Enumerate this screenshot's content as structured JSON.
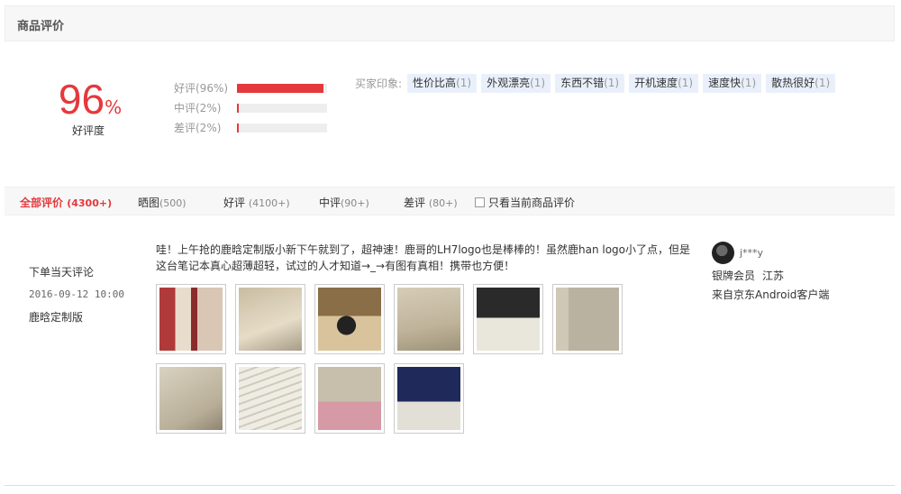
{
  "section": {
    "title": "商品评价"
  },
  "rating": {
    "value": "96",
    "unit": "%",
    "label": "好评度"
  },
  "distribution": [
    {
      "label": "好评(96%)",
      "percent": 96
    },
    {
      "label": "中评(2%)",
      "percent": 2
    },
    {
      "label": "差评(2%)",
      "percent": 2
    }
  ],
  "impressions": {
    "label": "买家印象:",
    "tags": [
      {
        "text": "性价比高",
        "count": "(1)"
      },
      {
        "text": "外观漂亮",
        "count": "(1)"
      },
      {
        "text": "东西不错",
        "count": "(1)"
      },
      {
        "text": "开机速度",
        "count": "(1)"
      },
      {
        "text": "速度快",
        "count": "(1)"
      },
      {
        "text": "散热很好",
        "count": "(1)"
      }
    ]
  },
  "filters": {
    "tabs": [
      {
        "label": "全部评价",
        "count": "(4300+)",
        "active": true
      },
      {
        "label": "晒图",
        "count": "(500)"
      },
      {
        "label": "好评",
        "count": "(4100+)"
      },
      {
        "label": "中评",
        "count": "(90+)"
      },
      {
        "label": "差评",
        "count": "(80+)"
      }
    ],
    "only_current_label": "只看当前商品评价"
  },
  "review": {
    "timing": "下单当天评论",
    "date": "2016-09-12 10:00",
    "variant": "鹿晗定制版",
    "text": "哇！上午抢的鹿晗定制版小新下午就到了，超神速！鹿哥的LH7logo也是棒棒的！虽然鹿han logo小了点，但是这台笔记本真心超薄超轻，试过的人才知道→_→有图有真相！携带也方便！",
    "images": [
      {
        "name": "photo-box-pink"
      },
      {
        "name": "photo-laptop-lid"
      },
      {
        "name": "photo-charger"
      },
      {
        "name": "photo-lid-logo"
      },
      {
        "name": "photo-laptop-open"
      },
      {
        "name": "photo-laptop-side"
      },
      {
        "name": "photo-lid-signature"
      },
      {
        "name": "photo-keyboard"
      },
      {
        "name": "photo-laptop-edge"
      },
      {
        "name": "photo-boot-screen"
      }
    ],
    "user": {
      "name": "j***y",
      "level": "银牌会员",
      "region": "江苏",
      "source": "来自京东Android客户端"
    }
  }
}
